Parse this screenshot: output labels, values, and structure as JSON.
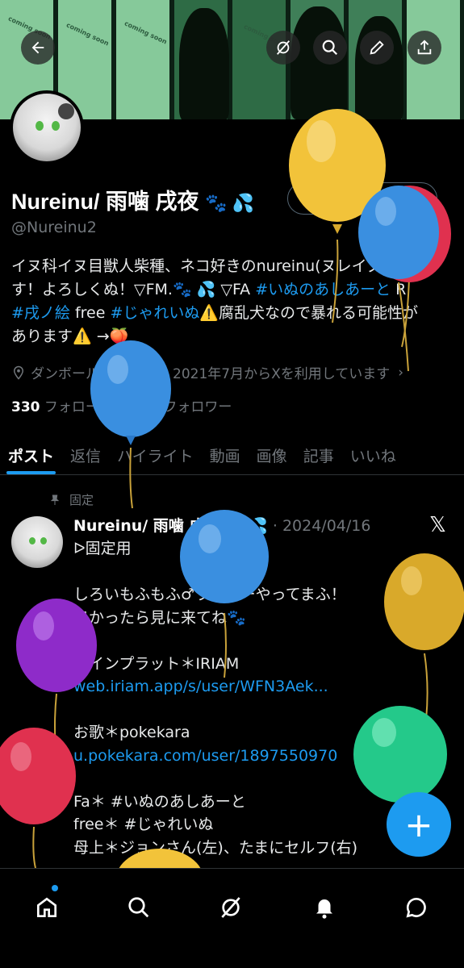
{
  "banner": {
    "coming_soon_texts": [
      "coming soon",
      "coming soon",
      "coming soon",
      "coming soon"
    ]
  },
  "header_buttons": {
    "back": "back-icon",
    "grok": "grok-icon",
    "search": "search-icon",
    "edit": "pencil-icon",
    "share": "share-icon"
  },
  "profile": {
    "name": "Nureinu/ 雨噛 戌夜",
    "name_emoji": "🐾 💦",
    "handle": "@Nureinu2",
    "follow_button": "認証を受ける",
    "bio_line1": "イヌ科イヌ目獣人柴種、ネコ好きのnureinu(ヌレイヌ)っ",
    "bio_line2a": "す！よろしくぬ！▽FM.🐾 💦 ▽FA ",
    "bio_tag1": "#いぬのあしあーと",
    "bio_line2b": " R",
    "bio_tag2": "#戌ノ絵",
    "bio_line3a": " free ",
    "bio_tag3": "#じゃれいぬ",
    "bio_line3b": "⚠️腐乱犬なので暴れる可能性が",
    "bio_line4": "あります⚠️ →🍑",
    "location": "ダンボールの中！",
    "joined": "2021年7月からXを利用しています",
    "following_count": "330",
    "following_label": "フォロー中",
    "followers_count": "300",
    "followers_label": "フォロワー"
  },
  "tabs": [
    "ポスト",
    "返信",
    "ハイライト",
    "動画",
    "画像",
    "記事",
    "いいね"
  ],
  "pinned_label": "固定",
  "tweet": {
    "name": "Nureinu/ 雨噛 戌夜",
    "emoji": "🐾 💦",
    "date": "· 2024/04/16",
    "lines": [
      "ᐅ固定用",
      "",
      "しろいもふもふ♂ライバーやってまふ！",
      "良かったら見に来てね🐾",
      "",
      "メインプラット＊IRIAM",
      "web.iriam.app/s/user/WFN3Aek...",
      "",
      "お歌＊pokekara",
      "u.pokekara.com/user/1897550970",
      "",
      "Fa＊ #いぬのあしあーと",
      "free＊ #じゃれいぬ",
      "母上＊ジョンさん(左)、たまにセルフ(右)"
    ]
  },
  "fab": "+",
  "nav": [
    "home-icon",
    "search-icon",
    "grok-icon",
    "notifications-icon",
    "messages-icon"
  ],
  "balloon_colors": {
    "yellow": "#f2c33a",
    "blue": "#3a8fe0",
    "red": "#e0314f",
    "purple": "#8e2bc9",
    "green": "#24c98a",
    "accent": "#1d9bf0"
  }
}
